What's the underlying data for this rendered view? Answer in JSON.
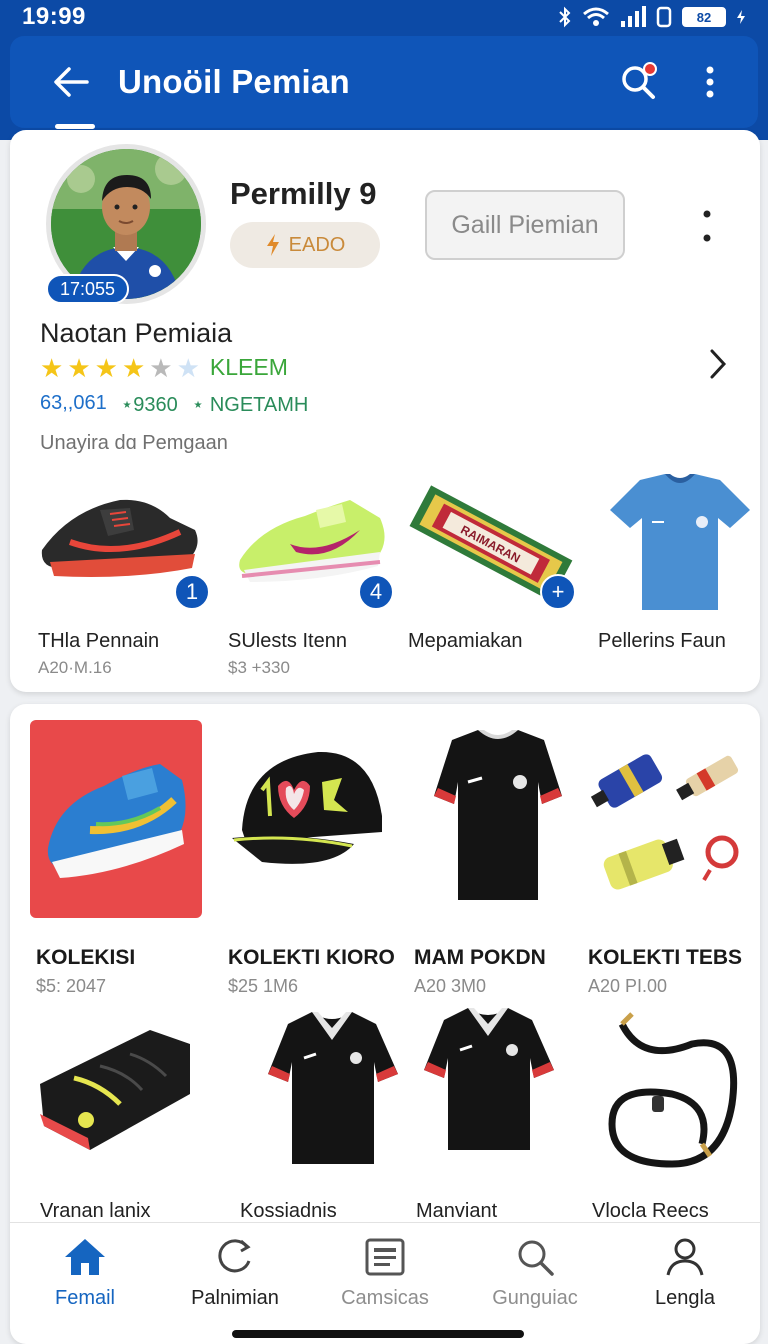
{
  "status_bar": {
    "time": "19:99",
    "battery": "82"
  },
  "app_bar": {
    "title": "Unoöil Pemian"
  },
  "profile": {
    "name": "Permilly 9",
    "badge": "17:055",
    "pill_label": "EADO",
    "action_button": "Gaill Piemian",
    "section_name": "Naotan Pemiaia",
    "rating": 3.5,
    "rating_label": "KLEEM",
    "stats": [
      "63,,061",
      "⋆9360",
      "⋆ NGETAMH"
    ],
    "subtitle": "Unayira dɑ Pemgaan"
  },
  "featured_products": [
    {
      "name": "THla Pennain",
      "price": "A20·M.16",
      "badge": "1",
      "icon": "sneaker-black-icon"
    },
    {
      "name": "SUlests Itenn",
      "price": "$3 +330",
      "badge": "4",
      "icon": "sneaker-lime-icon"
    },
    {
      "name": "Mepamiakan",
      "price": "",
      "badge": "+",
      "icon": "scarf-icon"
    },
    {
      "name": "Pellerins Faun",
      "price": "",
      "badge": "",
      "icon": "blue-jersey-icon"
    }
  ],
  "collection_grid": [
    {
      "name": "KOLEKISI",
      "price": "$5: 2047",
      "icon": "running-shoe-icon"
    },
    {
      "name": "KOLEKTI KIORO",
      "price": "$25 1M6",
      "icon": "cap-icon"
    },
    {
      "name": "MAM POKDN",
      "price": "A20 3M0",
      "icon": "black-jersey-icon"
    },
    {
      "name": "KOLEKTI TEBS",
      "price": "A20 PI.00",
      "icon": "accessories-icon"
    }
  ],
  "collection_grid_2": [
    {
      "name": "Vranan lanix",
      "icon": "glove-icon"
    },
    {
      "name": "Kossiadnis",
      "icon": "polo-shirt-icon"
    },
    {
      "name": "Manviant",
      "icon": "polo-shirt-icon"
    },
    {
      "name": "Vlocla Reecs",
      "icon": "cable-icon"
    }
  ],
  "bottom_nav": [
    {
      "label": "Femail",
      "icon": "home-icon"
    },
    {
      "label": "Palnimian",
      "icon": "refresh-icon"
    },
    {
      "label": "Camsicas",
      "icon": "document-icon"
    },
    {
      "label": "Gunguiac",
      "icon": "search-icon"
    },
    {
      "label": "Lengla",
      "icon": "profile-icon"
    }
  ],
  "colors": {
    "primary": "#0f55b8",
    "accent_green": "#3aa63a",
    "star": "#f5c518"
  }
}
